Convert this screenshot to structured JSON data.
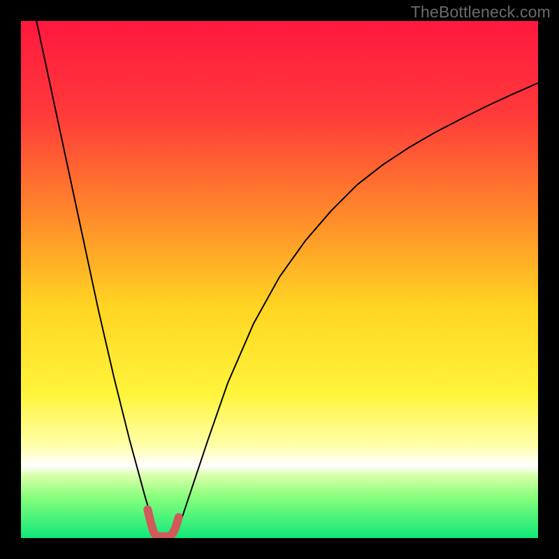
{
  "watermark": {
    "text": "TheBottleneck.com"
  },
  "chart_data": {
    "type": "line",
    "title": "",
    "xlabel": "",
    "ylabel": "",
    "xlim": [
      0,
      1
    ],
    "ylim": [
      0,
      1
    ],
    "background_gradient": {
      "stops": [
        {
          "offset": 0.0,
          "color": "#ff183f"
        },
        {
          "offset": 0.18,
          "color": "#ff3a3a"
        },
        {
          "offset": 0.38,
          "color": "#ff8b2a"
        },
        {
          "offset": 0.55,
          "color": "#ffd423"
        },
        {
          "offset": 0.72,
          "color": "#fff43a"
        },
        {
          "offset": 0.82,
          "color": "#ffffa8"
        },
        {
          "offset": 0.86,
          "color": "#ffffff"
        },
        {
          "offset": 0.88,
          "color": "#d8ffa8"
        },
        {
          "offset": 0.92,
          "color": "#89ff7c"
        },
        {
          "offset": 1.0,
          "color": "#10e87a"
        }
      ]
    },
    "series": [
      {
        "name": "curve",
        "stroke": "#000000",
        "stroke_width": 2,
        "x": [
          0.03,
          0.06,
          0.09,
          0.12,
          0.15,
          0.18,
          0.21,
          0.24,
          0.252,
          0.256,
          0.26,
          0.265,
          0.27,
          0.278,
          0.285,
          0.29,
          0.295,
          0.3,
          0.31,
          0.33,
          0.36,
          0.4,
          0.45,
          0.5,
          0.55,
          0.6,
          0.65,
          0.7,
          0.75,
          0.8,
          0.85,
          0.9,
          0.95,
          1.0
        ],
        "y": [
          1.0,
          0.86,
          0.72,
          0.58,
          0.44,
          0.31,
          0.19,
          0.08,
          0.04,
          0.024,
          0.012,
          0.006,
          0.004,
          0.003,
          0.004,
          0.006,
          0.01,
          0.016,
          0.035,
          0.095,
          0.185,
          0.3,
          0.415,
          0.505,
          0.575,
          0.633,
          0.683,
          0.722,
          0.755,
          0.784,
          0.81,
          0.835,
          0.858,
          0.88
        ]
      },
      {
        "name": "marker-band",
        "stroke": "#d05a5a",
        "stroke_width": 12,
        "stroke_linecap": "round",
        "x": [
          0.245,
          0.251,
          0.257,
          0.263,
          0.269,
          0.275,
          0.281,
          0.287,
          0.293,
          0.299,
          0.305
        ],
        "y": [
          0.055,
          0.03,
          0.01,
          0.004,
          0.003,
          0.003,
          0.003,
          0.004,
          0.008,
          0.02,
          0.04
        ]
      }
    ]
  }
}
